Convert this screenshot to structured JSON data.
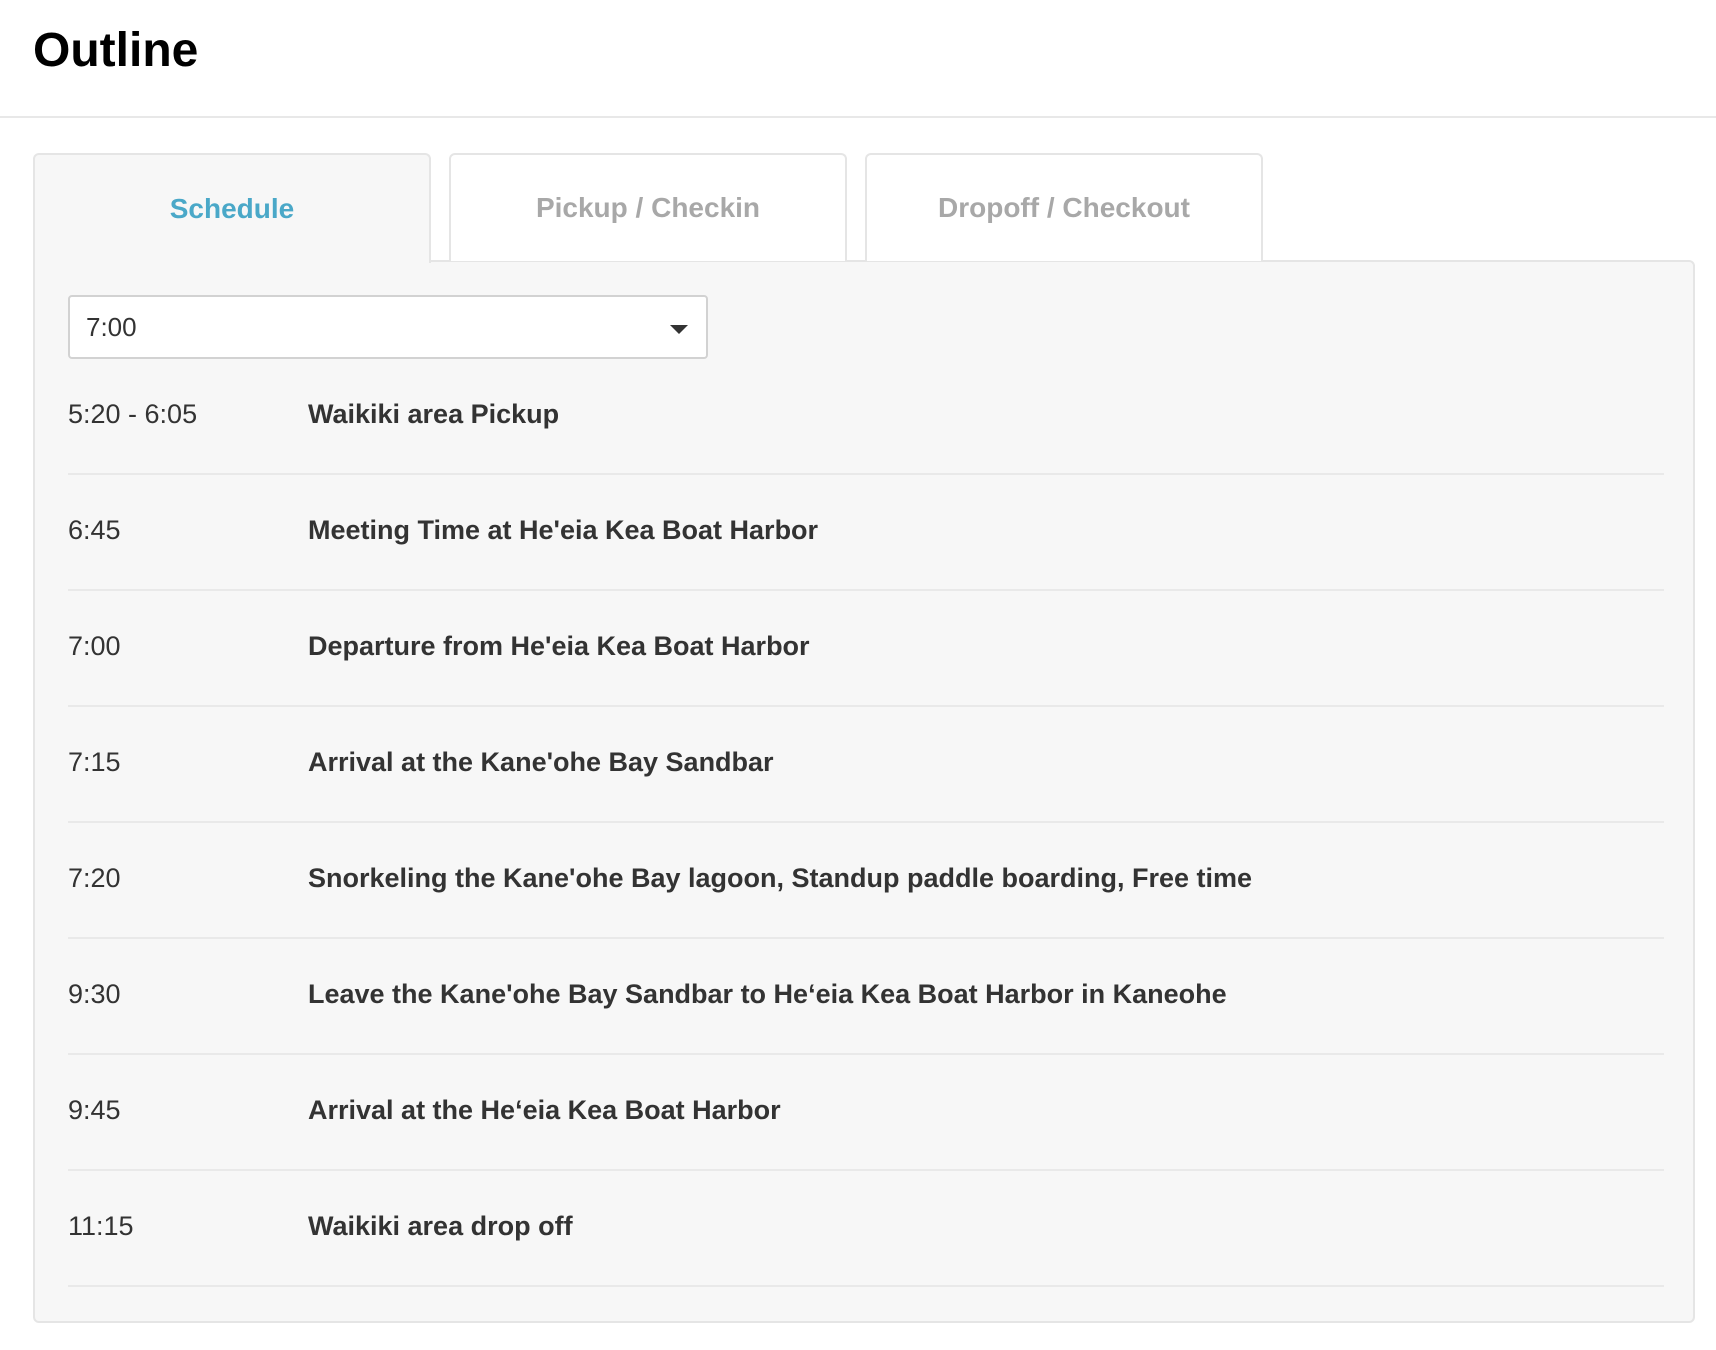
{
  "page": {
    "title": "Outline"
  },
  "tabs": [
    {
      "label": "Schedule",
      "active": true
    },
    {
      "label": "Pickup / Checkin",
      "active": false
    },
    {
      "label": "Dropoff / Checkout",
      "active": false
    }
  ],
  "time_select": {
    "value": "7:00",
    "icon": "caret-down-icon"
  },
  "schedule": [
    {
      "time": "5:20 - 6:05",
      "activity": "Waikiki area Pickup"
    },
    {
      "time": "6:45",
      "activity": "Meeting Time at He'eia Kea Boat Harbor"
    },
    {
      "time": "7:00",
      "activity": "Departure from He'eia Kea Boat Harbor"
    },
    {
      "time": "7:15",
      "activity": "Arrival at the Kane'ohe Bay Sandbar"
    },
    {
      "time": "7:20",
      "activity": "Snorkeling the Kane'ohe Bay lagoon, Standup paddle boarding, Free time"
    },
    {
      "time": "9:30",
      "activity": "Leave the Kane'ohe Bay Sandbar to He‘eia Kea Boat Harbor in Kaneohe"
    },
    {
      "time": "9:45",
      "activity": "Arrival at the He‘eia Kea Boat Harbor"
    },
    {
      "time": "11:15",
      "activity": "Waikiki area drop off"
    }
  ],
  "colors": {
    "active_tab_text": "#4aa8c8",
    "inactive_tab_text": "#a8a8a8",
    "panel_background": "#f7f7f7",
    "divider": "#e9e9e9"
  }
}
